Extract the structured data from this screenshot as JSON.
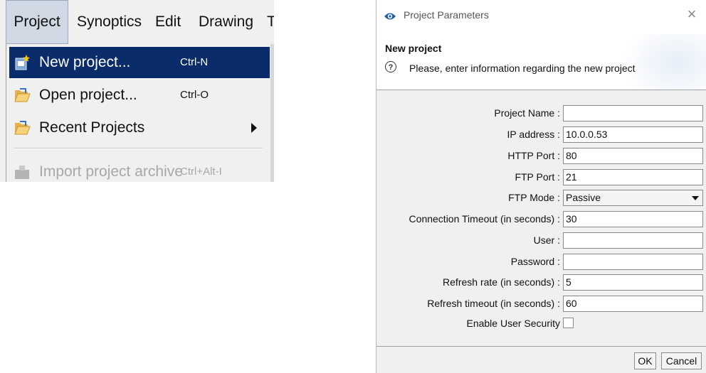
{
  "menubar": {
    "items": [
      "Project",
      "Synoptics",
      "Edit",
      "Drawing",
      "T"
    ]
  },
  "project_menu": {
    "items": [
      {
        "label": "New project...",
        "shortcut": "Ctrl-N",
        "icon": "new-project-icon"
      },
      {
        "label": "Open project...",
        "shortcut": "Ctrl-O",
        "icon": "open-folder-icon"
      },
      {
        "label": "Recent Projects",
        "shortcut": "",
        "icon": "open-folder-icon"
      },
      {
        "label": "Import project archive",
        "shortcut": "Ctrl+Alt-I",
        "icon": "archive-icon"
      }
    ]
  },
  "dialog": {
    "title": "Project Parameters",
    "header_title": "New project",
    "header_message": "Please, enter information  regarding the new project",
    "fields": [
      {
        "label": "Project Name :",
        "value": ""
      },
      {
        "label": "IP address :",
        "value": "10.0.0.53"
      },
      {
        "label": "HTTP Port :",
        "value": "80"
      },
      {
        "label": "FTP Port :",
        "value": "21"
      },
      {
        "label": "FTP Mode :",
        "value": "Passive"
      },
      {
        "label": "Connection Timeout (in seconds) :",
        "value": "30"
      },
      {
        "label": "User :",
        "value": ""
      },
      {
        "label": "Password :",
        "value": ""
      },
      {
        "label": "Refresh rate (in seconds) :",
        "value": "5"
      },
      {
        "label": "Refresh timeout (in seconds) :",
        "value": "60"
      }
    ],
    "checkbox": {
      "label": "Enable User Security",
      "checked": false
    },
    "ok_label": "OK",
    "cancel_label": "Cancel"
  }
}
